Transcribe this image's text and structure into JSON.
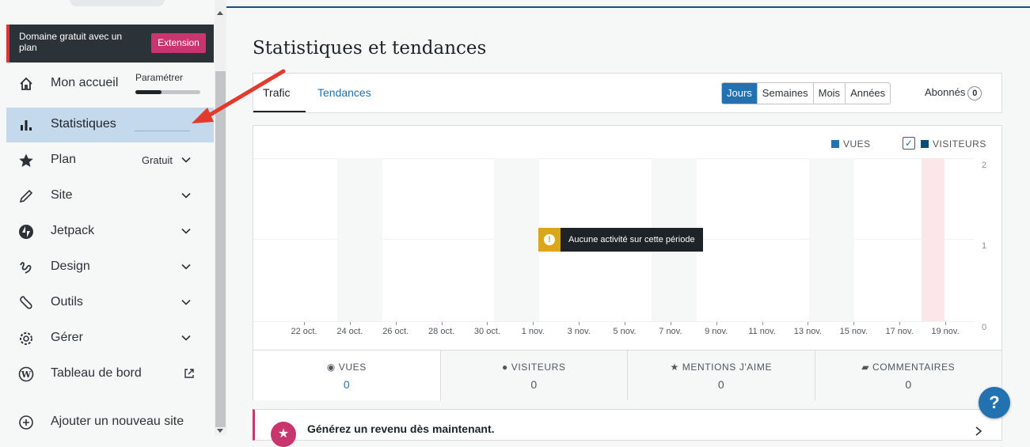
{
  "sidebar": {
    "domain_banner": {
      "text": "Domaine gratuit avec un plan",
      "button": "Extension"
    },
    "setup": {
      "label": "Paramétrer",
      "progress": 0.4
    },
    "items": [
      {
        "label": "Mon accueil",
        "icon": "home-icon"
      },
      {
        "label": "Statistiques",
        "icon": "stats-icon",
        "active": true
      },
      {
        "label": "Plan",
        "badge": "Gratuit",
        "icon": "star-icon"
      },
      {
        "label": "Site",
        "icon": "pencil-icon"
      },
      {
        "label": "Jetpack",
        "icon": "jetpack-icon"
      },
      {
        "label": "Design",
        "icon": "design-icon"
      },
      {
        "label": "Outils",
        "icon": "tools-icon"
      },
      {
        "label": "Gérer",
        "icon": "gear-icon"
      },
      {
        "label": "Tableau de bord",
        "icon": "wordpress-icon"
      },
      {
        "label": "Ajouter un nouveau site",
        "icon": "plus-circle-icon"
      }
    ]
  },
  "main": {
    "title": "Statistiques et tendances",
    "tabs": [
      {
        "label": "Trafic",
        "active": true
      },
      {
        "label": "Tendances"
      }
    ],
    "periods": [
      {
        "label": "Jours",
        "selected": true
      },
      {
        "label": "Semaines"
      },
      {
        "label": "Mois"
      },
      {
        "label": "Années"
      }
    ],
    "subscribers": {
      "label": "Abonnés",
      "count": "0"
    },
    "chart": {
      "legend": [
        {
          "label": "VUES",
          "color": "#2271b1"
        },
        {
          "label": "VISITEURS",
          "color": "#0a4b78",
          "checked": true
        }
      ],
      "no_activity": "Aucune activité sur cette période",
      "accent_color": "#dba617"
    },
    "stats": [
      {
        "label": "VUES",
        "value": "0",
        "icon": "eye-icon"
      },
      {
        "label": "VISITEURS",
        "value": "0",
        "icon": "user-icon"
      },
      {
        "label": "MENTIONS J'AIME",
        "value": "0",
        "icon": "star-icon"
      },
      {
        "label": "COMMENTAIRES",
        "value": "0",
        "icon": "comment-icon"
      }
    ],
    "revenue_card": {
      "text": "Générez un revenu dès maintenant."
    },
    "help_label": "?"
  },
  "chart_data": {
    "type": "bar",
    "categories": [
      "22 oct.",
      "24 oct.",
      "26 oct.",
      "28 oct.",
      "30 oct.",
      "1 nov.",
      "3 nov.",
      "5 nov.",
      "7 nov.",
      "9 nov.",
      "11 nov.",
      "13 nov.",
      "15 nov.",
      "17 nov.",
      "19 nov."
    ],
    "series": [
      {
        "name": "VUES",
        "values": [
          0,
          0,
          0,
          0,
          0,
          0,
          0,
          0,
          0,
          0,
          0,
          0,
          0,
          0,
          0
        ]
      },
      {
        "name": "VISITEURS",
        "values": [
          0,
          0,
          0,
          0,
          0,
          0,
          0,
          0,
          0,
          0,
          0,
          0,
          0,
          0,
          0
        ]
      }
    ],
    "yticks": [
      "0",
      "1",
      "2"
    ],
    "ylim": [
      0,
      2
    ],
    "grid": true,
    "legend_position": "top-right"
  }
}
